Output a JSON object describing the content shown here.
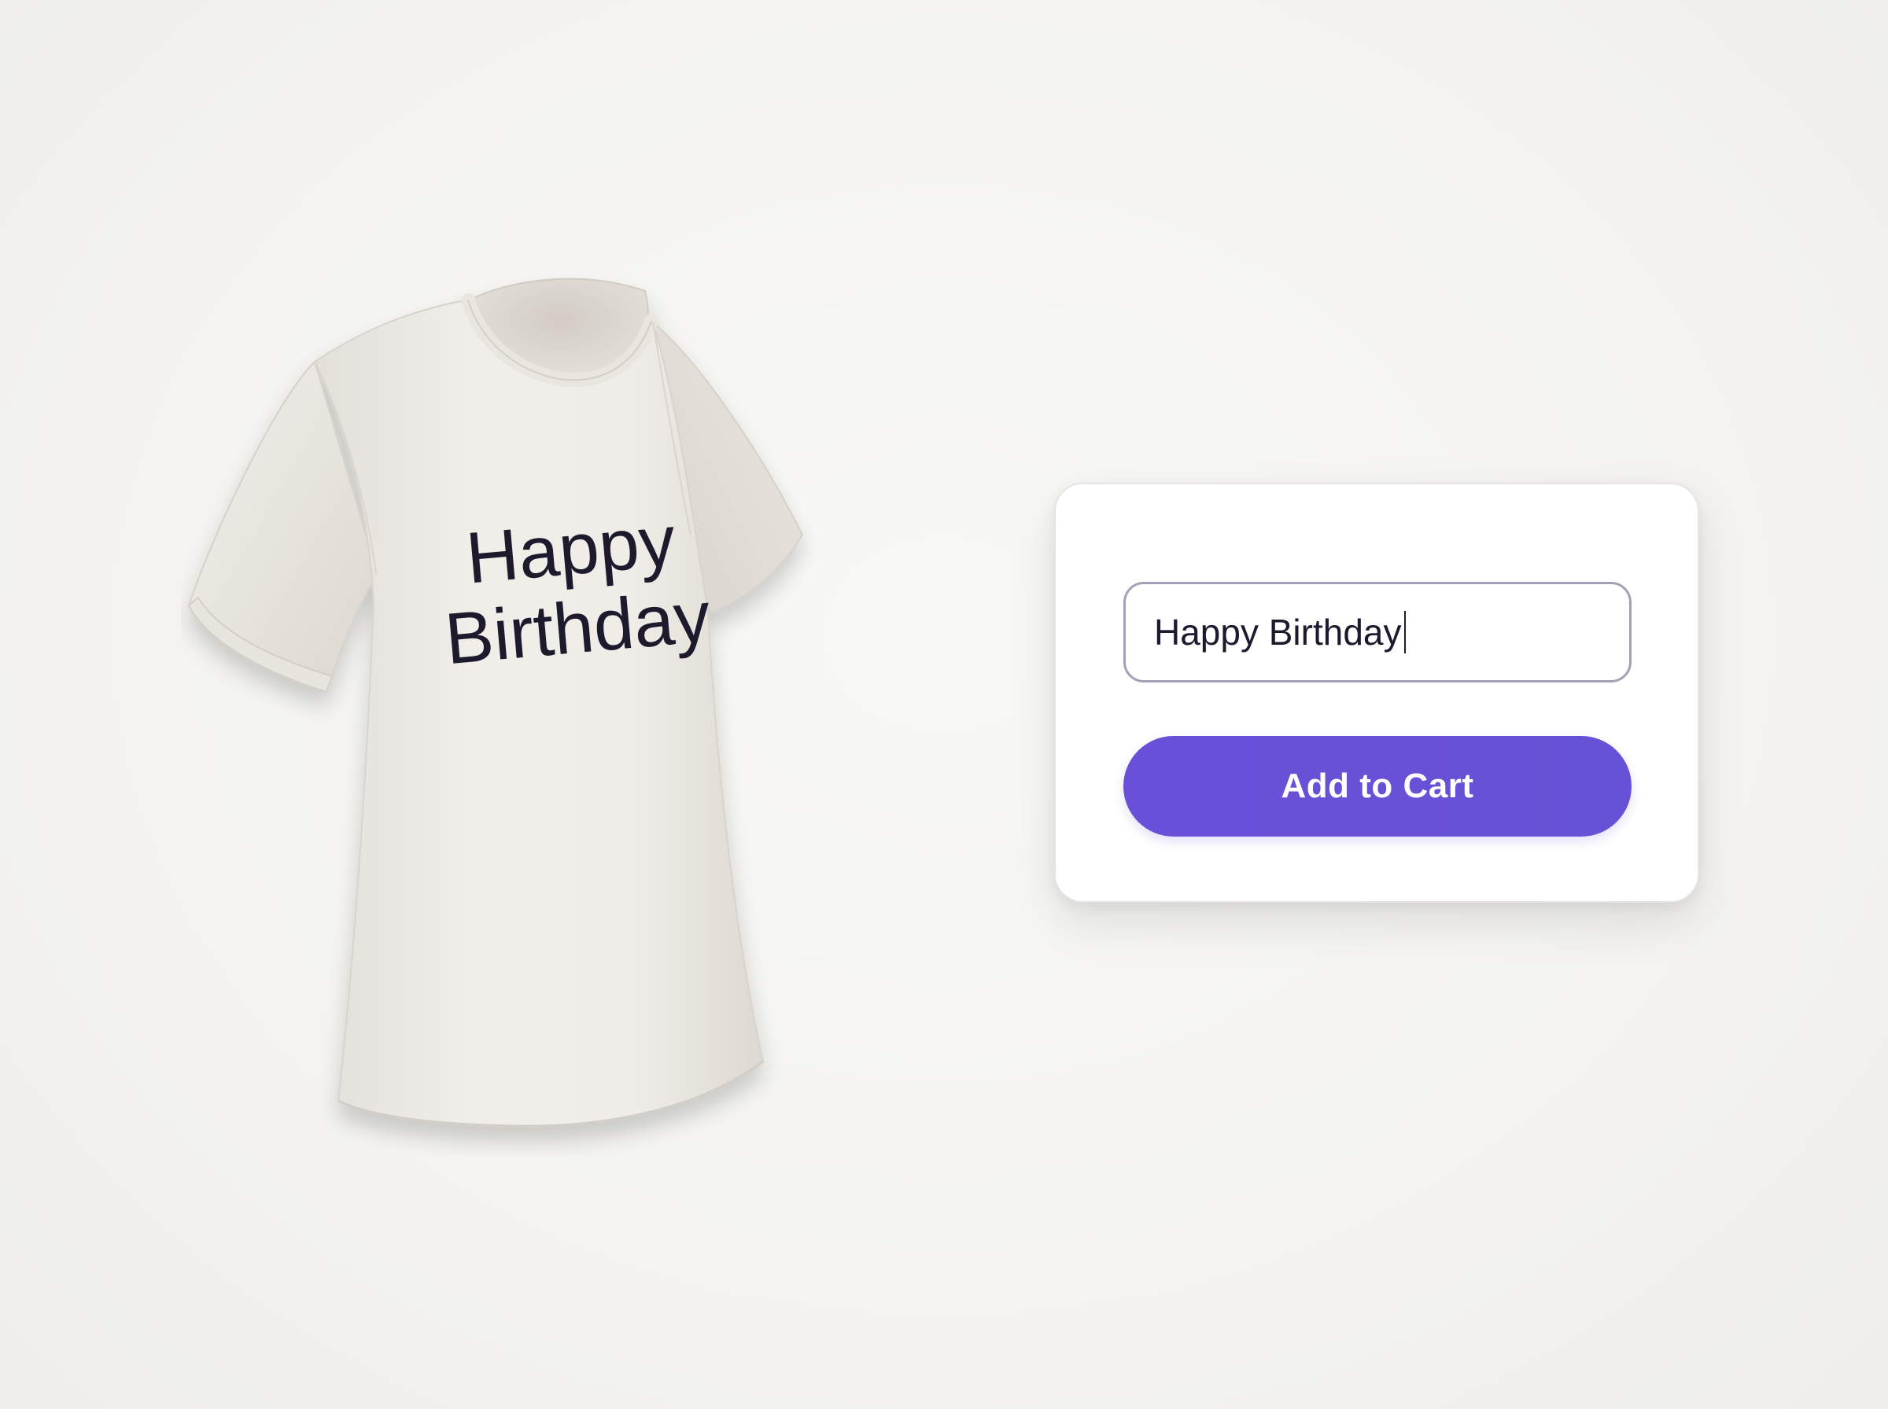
{
  "product": {
    "image_icon": "tshirt-icon",
    "print_line_1": "Happy",
    "print_line_2": "Birthday"
  },
  "customizer": {
    "text_value": "Happy Birthday",
    "add_to_cart_label": "Add to Cart"
  },
  "colors": {
    "accent": "#6652d6",
    "shirt": "#efece7",
    "print_text": "#1d1a2e",
    "background": "#f4f3ef"
  }
}
